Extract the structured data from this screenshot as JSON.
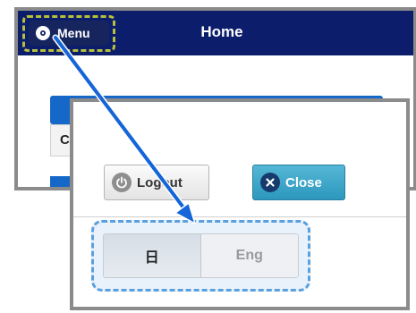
{
  "header": {
    "menu_label": "Menu",
    "title": "Home"
  },
  "background": {
    "row_text": "C"
  },
  "panel": {
    "logout_label": "Logout",
    "close_label": "Close",
    "languages": [
      {
        "label": "日",
        "selected": true
      },
      {
        "label": "Eng",
        "selected": false
      }
    ]
  },
  "colors": {
    "header": "#0c1d6b",
    "highlight_menu": "#b6c03a",
    "highlight_lang": "#5aa0de",
    "arrow": "#1565d8",
    "close_button": "#2c97bd"
  },
  "icons": {
    "menu": "gear-icon",
    "logout": "power-icon",
    "close": "close-icon",
    "arrow": "arrow-icon"
  }
}
